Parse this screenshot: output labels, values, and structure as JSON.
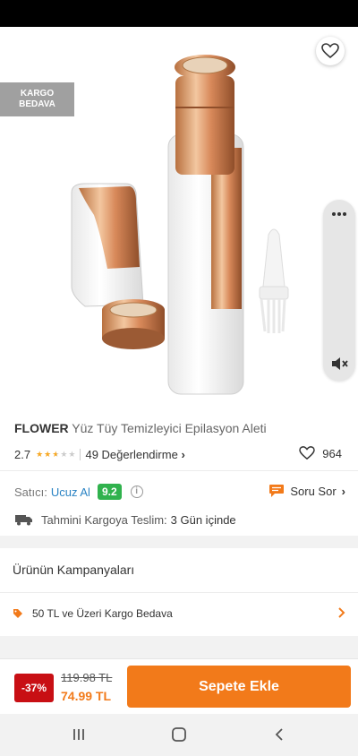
{
  "badges": {
    "free_shipping_line1": "KARGO",
    "free_shipping_line2": "BEDAVA"
  },
  "product": {
    "brand": "FLOWER",
    "name": "Yüz Tüy Temizleyici Epilasyon Aleti",
    "rating": "2.7",
    "rating_stars": 2.7,
    "reviews_label": "49 Değerlendirme",
    "favorites": "964"
  },
  "seller": {
    "label": "Satıcı:",
    "name": "Ucuz Al",
    "score": "9.2"
  },
  "ask": {
    "label": "Soru Sor"
  },
  "delivery": {
    "label": "Tahmini Kargoya Teslim:",
    "time": "3 Gün içinde"
  },
  "campaigns": {
    "title": "Ürünün Kampanyaları",
    "items": [
      {
        "label": "50 TL ve Üzeri Kargo Bedava"
      }
    ]
  },
  "pricing": {
    "discount": "-37%",
    "old_price": "119.98 TL",
    "new_price": "74.99 TL"
  },
  "cart": {
    "button_label": "Sepete Ekle"
  },
  "colors": {
    "accent": "#f27a1a",
    "discount": "#c80f14",
    "seller_score": "#30b24d",
    "link": "#2a83c4"
  },
  "icons": [
    "back-arrow-icon",
    "share-icon",
    "heart-icon",
    "more-icon",
    "mute-icon",
    "info-icon",
    "chat-icon",
    "truck-icon",
    "tag-icon",
    "chevron-right-icon",
    "recents-icon",
    "home-icon",
    "back-icon"
  ]
}
